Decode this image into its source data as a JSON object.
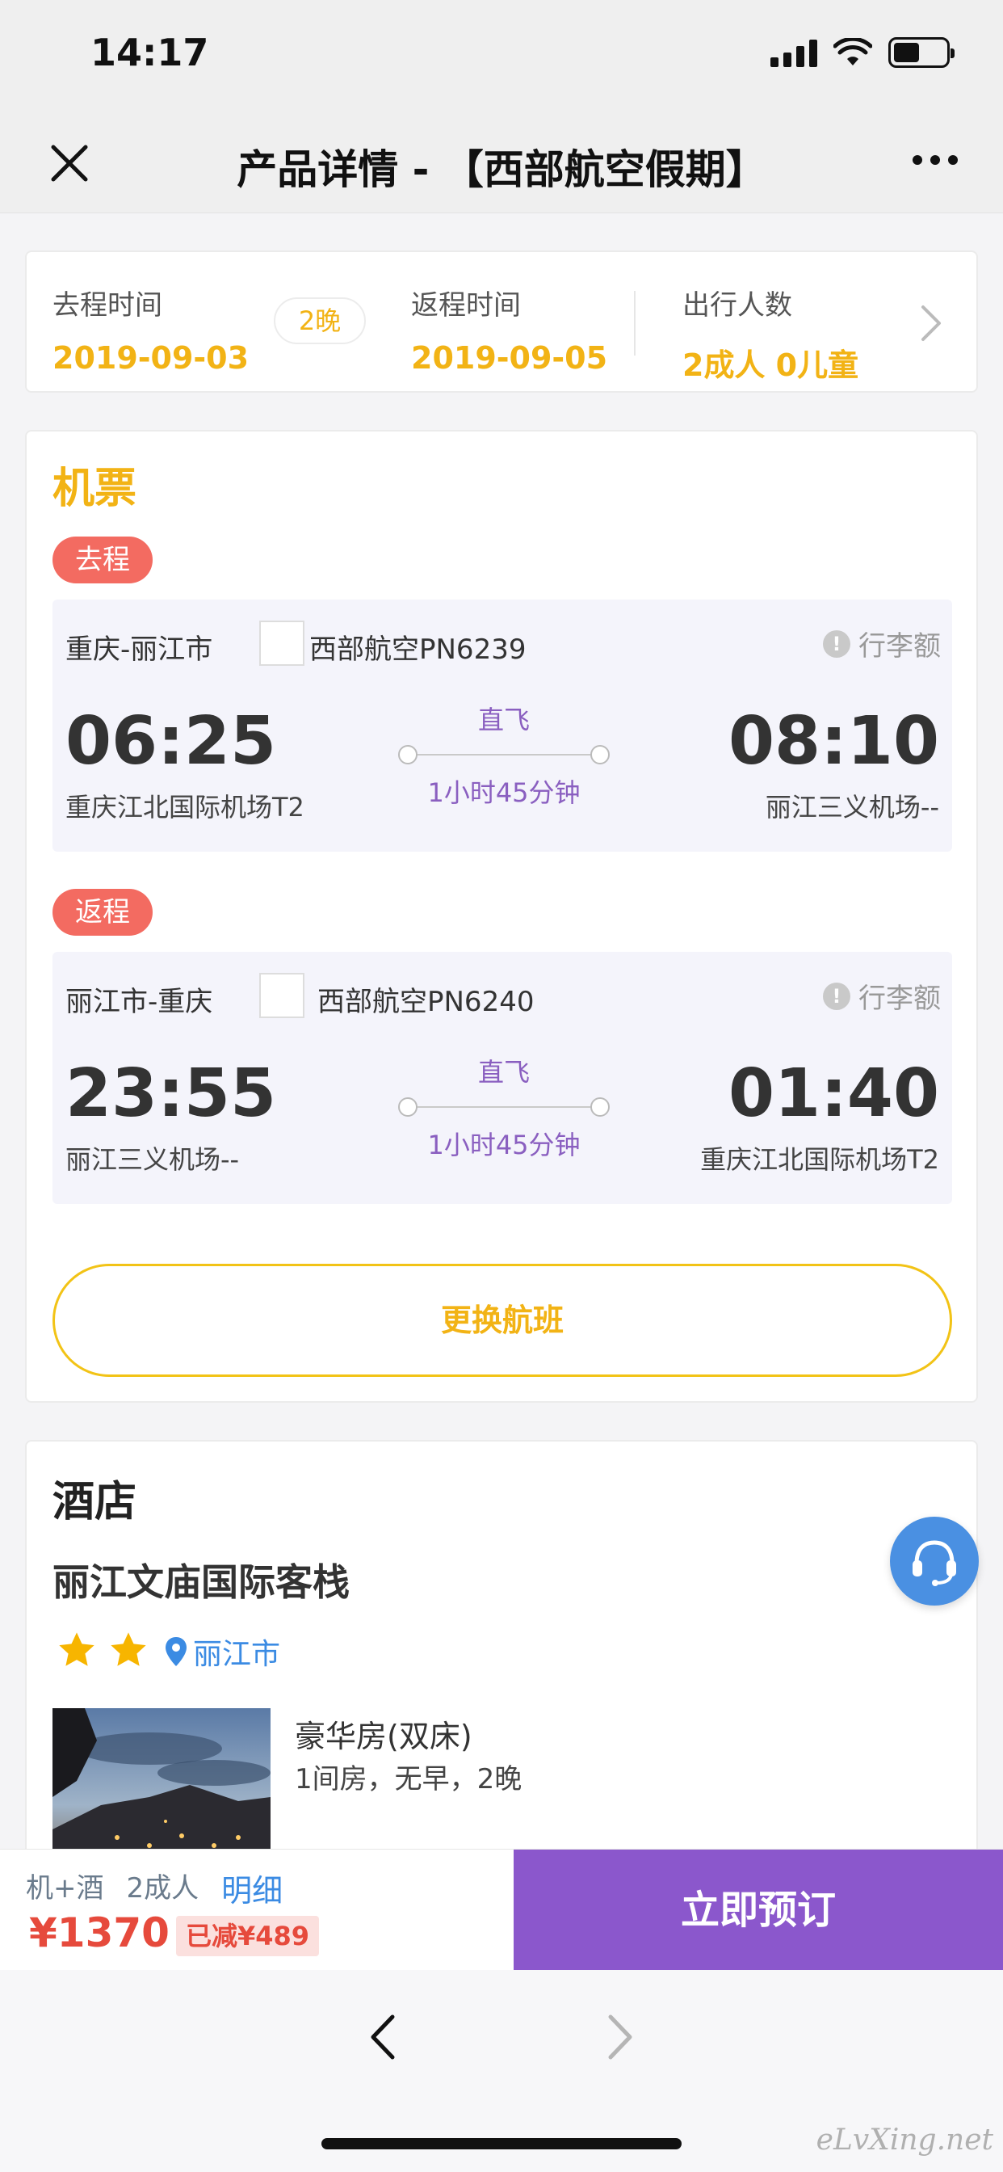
{
  "status_bar": {
    "time": "14:17"
  },
  "nav": {
    "title": "产品详情 - 【西部航空假期】"
  },
  "trip": {
    "depart_label": "去程时间",
    "depart_date": "2019-09-03",
    "nights": "2晚",
    "return_label": "返程时间",
    "return_date": "2019-09-05",
    "travelers_label": "出行人数",
    "travelers": "2成人 0儿童"
  },
  "flights": {
    "section_title": "机票",
    "outbound": {
      "badge": "去程",
      "route": "重庆-丽江市",
      "airline": "西部航空PN6239",
      "baggage": "行李额",
      "dep_time": "06:25",
      "dep_airport": "重庆江北国际机场T2",
      "type": "直飞",
      "duration": "1小时45分钟",
      "arr_time": "08:10",
      "arr_airport": "丽江三义机场--"
    },
    "return": {
      "badge": "返程",
      "route": "丽江市-重庆",
      "airline": "西部航空PN6240",
      "baggage": "行李额",
      "dep_time": "23:55",
      "dep_airport": "丽江三义机场--",
      "type": "直飞",
      "duration": "1小时45分钟",
      "arr_time": "01:40",
      "arr_airport": "重庆江北国际机场T2"
    },
    "change_button": "更换航班"
  },
  "hotel": {
    "section_title": "酒店",
    "name": "丽江文庙国际客栈",
    "stars": 2,
    "location": "丽江市",
    "room_name": "豪华房(双床)",
    "room_detail": "1间房，无早，2晚"
  },
  "booking": {
    "package": "机+酒",
    "adults": "2成人",
    "detail_link": "明细",
    "price": "¥1370",
    "discount": "已减¥489",
    "book_button": "立即预订"
  },
  "watermark": "eLvXing.net",
  "colors": {
    "accent_yellow": "#f2b315",
    "purple": "#8b57cc",
    "badge_red": "#f36b61",
    "price_red": "#e64a3c",
    "link_blue": "#3b8be3"
  }
}
